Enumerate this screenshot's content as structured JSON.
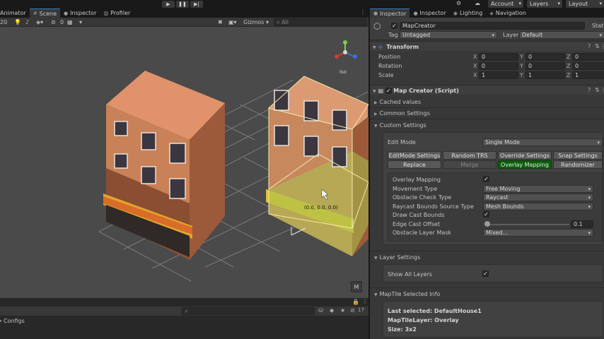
{
  "toolbar": {
    "account_label": "Account",
    "layers_label": "Layers",
    "layout_label": "Layout"
  },
  "left_tabs": [
    {
      "label": "Animator"
    },
    {
      "label": "Scene"
    },
    {
      "label": "Inspector"
    },
    {
      "label": "Profiler"
    }
  ],
  "scene_toolbar": {
    "render_value": "20",
    "gizmos_label": "Gizmos",
    "search_placeholder": "All",
    "hidden_count": "0"
  },
  "scene": {
    "gizmo_label": "Iso",
    "overlay_text": "(0.0, 0.0, 0.0)",
    "m_button_label": "M"
  },
  "bottom": {
    "configs_label": "Configs",
    "count_badge": "17"
  },
  "inspector_tabs": [
    {
      "label": "Inspector"
    },
    {
      "label": "Inspector"
    },
    {
      "label": "Lighting"
    },
    {
      "label": "Navigation"
    }
  ],
  "object": {
    "name": "MapCreator",
    "static_label": "Static",
    "tag_label": "Tag",
    "tag_value": "Untagged",
    "layer_label": "Layer",
    "layer_value": "Default"
  },
  "transform": {
    "title": "Transform",
    "rows": [
      {
        "label": "Position",
        "x": "0",
        "y": "0",
        "z": "0"
      },
      {
        "label": "Rotation",
        "x": "0",
        "y": "0",
        "z": "0"
      },
      {
        "label": "Scale",
        "x": "1",
        "y": "1",
        "z": "1"
      }
    ],
    "axis_x": "X",
    "axis_y": "Y",
    "axis_z": "Z"
  },
  "script": {
    "title": "Map Creator (Script)",
    "cached_values": "Cached values",
    "common_settings": "Common Settings",
    "custom_settings": "Custom Settings",
    "edit_mode_label": "Edit Mode",
    "edit_mode_value": "Single Mode",
    "buttons_row1": [
      "EditMode Settings",
      "Random TRS",
      "Override Settings",
      "Snap Settings"
    ],
    "buttons_row2": [
      "Replace",
      "Merge",
      "Overlay Mapping",
      "Randomizer"
    ],
    "props": [
      {
        "label": "Overlay Mapping",
        "kind": "check",
        "value": "✓"
      },
      {
        "label": "Movement Type",
        "kind": "dropdown",
        "value": "Free Moving"
      },
      {
        "label": "Obstacle Check Type",
        "kind": "dropdown",
        "value": "Raycast"
      },
      {
        "label": "Raycast Bounds Source Type",
        "kind": "dropdown",
        "value": "Mesh Bounds"
      },
      {
        "label": "Draw Cast Bounds",
        "kind": "check",
        "value": "✓"
      },
      {
        "label": "Edge Cast Offset",
        "kind": "slider",
        "value": "0.1",
        "fraction": 0.0
      },
      {
        "label": "Obstacle Layer Mask",
        "kind": "dropdown",
        "value": "Mixed..."
      }
    ],
    "layer_settings": "Layer Settings",
    "show_all_layers_label": "Show All Layers",
    "show_all_layers_value": "✓",
    "tile_info_title": "MapTile Selected Info",
    "last_selected": "Last selected: DefaultHouse1",
    "map_tile_layer": "MapTileLayer: Overlay",
    "size": "Size: 3x2"
  },
  "colors": {
    "accent_green": "#0b5e0b",
    "tab_highlight": "#3a79bb",
    "scene_bg": "#4a4a4a"
  }
}
